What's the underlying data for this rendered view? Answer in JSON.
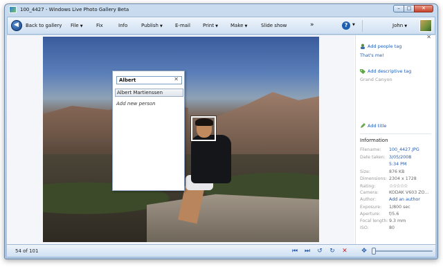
{
  "window": {
    "title": "100_4427 - Windows Live Photo Gallery Beta",
    "controls": [
      "–",
      "□",
      "✕"
    ]
  },
  "menubar": {
    "back": "Back to gallery",
    "file": "File",
    "fix": "Fix",
    "info": "Info",
    "publish": "Publish",
    "email": "E-mail",
    "print": "Print",
    "make": "Make",
    "slideshow": "Slide show",
    "more": "»",
    "help": "?",
    "user": "John"
  },
  "tag_panel": {
    "input_value": "Albert",
    "clear": "✕",
    "suggestion": "Albert Martienssen",
    "add_new": "Add new person"
  },
  "sidebar": {
    "add_people_tag": "Add people tag",
    "thats_me": "That's me!",
    "add_descriptive_tag": "Add descriptive tag",
    "descriptive_tag": "Grand Canyon",
    "add_title": "Add title",
    "close": "✕",
    "information": "Information",
    "info": [
      {
        "key": "Filename:",
        "value": "100_4427.JPG",
        "link": true
      },
      {
        "key": "Date taken:",
        "value": "3/05/2008",
        "link": true
      },
      {
        "key": "",
        "value": "5:34 PM",
        "link": true
      },
      {
        "key": "Size:",
        "value": "876 KB",
        "link": false
      },
      {
        "key": "Dimensions:",
        "value": "2304 x 1728",
        "link": false
      },
      {
        "key": "Rating:",
        "value": "☆☆☆☆☆",
        "link": false
      },
      {
        "key": "Camera:",
        "value": "KODAK V603 ZO...",
        "link": false
      },
      {
        "key": "Author:",
        "value": "Add an author",
        "link": true
      },
      {
        "key": "Exposure:",
        "value": "1/800 sec",
        "link": false
      },
      {
        "key": "Aperture:",
        "value": "f/5.6",
        "link": false
      },
      {
        "key": "Focal length:",
        "value": "9.3 mm",
        "link": false
      },
      {
        "key": "ISO:",
        "value": "80",
        "link": false
      }
    ]
  },
  "statusbar": {
    "count": "54 of 101",
    "first": "⏮",
    "next": "⏭",
    "rotate_left": "↺",
    "rotate_right": "↻",
    "delete": "✕",
    "zoom_icon": "✥"
  }
}
